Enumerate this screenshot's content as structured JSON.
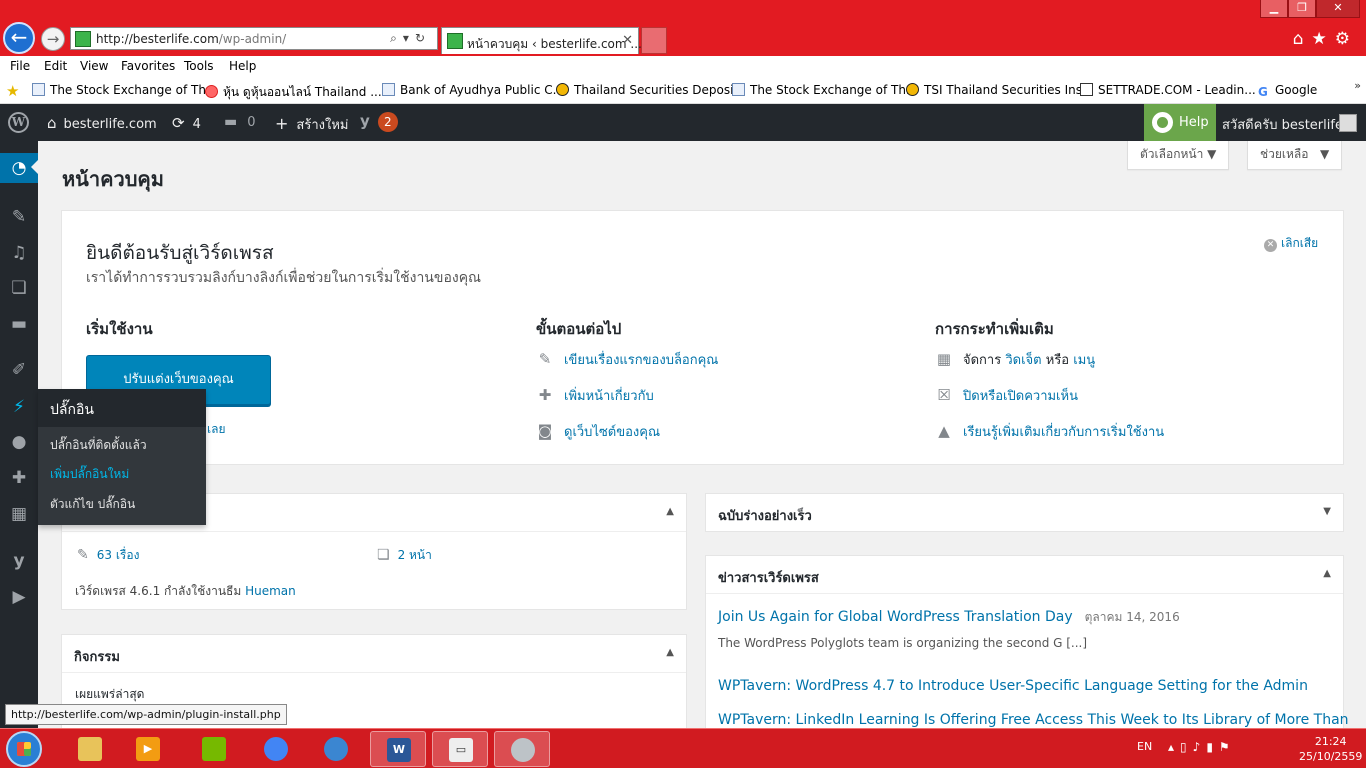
{
  "browser": {
    "url_host": "http://besterlife.com",
    "url_path": "/wp-admin/",
    "tab_title": "หน้าควบคุม ‹ besterlife.com ...",
    "status_url": "http://besterlife.com/wp-admin/plugin-install.php"
  },
  "menubar": [
    "File",
    "Edit",
    "View",
    "Favorites",
    "Tools",
    "Help"
  ],
  "favorites": [
    "The Stock Exchange of Th...",
    "หุ้น ดูหุ้นออนไลน์ Thailand ...",
    "Bank of Ayudhya Public C...",
    "Thailand Securities Deposi...",
    "The Stock Exchange of Th...",
    "TSI Thailand Securities Ins...",
    "SETTRADE.COM - Leadin...",
    "Google"
  ],
  "adminbar": {
    "site_name": "besterlife.com",
    "updates_count": "4",
    "comments_count": "0",
    "new_label": "สร้างใหม่",
    "yoast_badge": "2",
    "help_label": "Help",
    "howdy": "สวัสดีครับ besterlife"
  },
  "screen_meta": {
    "screen_options": "ตัวเลือกหน้า",
    "help": "ช่วยเหลือ"
  },
  "page_title": "หน้าควบคุม",
  "plugins_flyout": {
    "title": "ปลั๊กอิน",
    "items": [
      "ปลั๊กอินที่ติดตั้งแล้ว",
      "เพิ่มปลั๊กอินใหม่",
      "ตัวแก้ไข ปลั๊กอิน"
    ]
  },
  "welcome": {
    "title": "ยินดีต้อนรับสู่เวิร์ดเพรส",
    "about": "เราได้ทำการรวบรวมลิงก์บางลิงก์เพื่อช่วยในการเริ่มใช้งานของคุณ",
    "dismiss": "เลิกเสีย",
    "col1_title": "เริ่มใช้งาน",
    "customize_button": "ปรับแต่งเว็บของคุณ",
    "customize_link": "เลย",
    "col2_title": "ขั้นตอนต่อไป",
    "next_steps": [
      "เขียนเรื่องแรกของบล็อกคุณ",
      "เพิ่มหน้าเกี่ยวกับ",
      "ดูเว็บไซต์ของคุณ"
    ],
    "col3_title": "การกระทำเพิ่มเติม",
    "more_manage": "จัดการ",
    "more_widgets": "วิดเจ็ต",
    "more_or": "หรือ",
    "more_menus": "เมนู",
    "more_comments": "ปิดหรือเปิดความเห็น",
    "more_learn": "เรียนรู้เพิ่มเติมเกี่ยวกับการเริ่มใช้งาน"
  },
  "glance": {
    "posts": "63 เรื่อง",
    "pages": "2 หน้า",
    "footer_text": "เวิร์ดเพรส 4.6.1 กำลังใช้งานธีม ",
    "theme": "Hueman"
  },
  "activity": {
    "title": "กิจกรรม",
    "recent": "เผยแพร่ล่าสุด"
  },
  "quick_draft": {
    "title": "ฉบับร่างอย่างเร็ว"
  },
  "news": {
    "title": "ข่าวสารเวิร์ดเพรส",
    "items": [
      {
        "title": "Join Us Again for Global WordPress Translation Day",
        "date": "ตุลาคม 14, 2016",
        "desc": "The WordPress Polyglots team is organizing the second G [...]"
      },
      {
        "title": "WPTavern: WordPress 4.7 to Introduce User-Specific Language Setting for the Admin"
      },
      {
        "title": "WPTavern: LinkedIn Learning Is Offering Free Access This Week to Its Library of More Than"
      }
    ]
  },
  "taskbar": {
    "lang": "EN",
    "time": "21:24",
    "date": "25/10/2559"
  }
}
